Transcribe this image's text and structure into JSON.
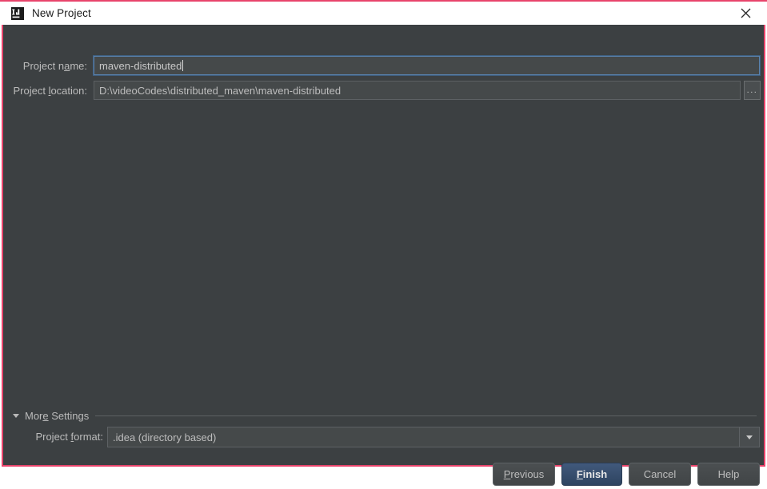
{
  "window": {
    "title": "New Project",
    "logo_icon": "intellij-idea-logo-icon",
    "close_icon": "close-icon",
    "border_color": "#e8446b",
    "titlebar_bg": "#ffffff",
    "body_bg": "#3c4042"
  },
  "fields": {
    "project_name": {
      "label_pre": "Project n",
      "label_mnemonic": "a",
      "label_post": "me:",
      "value": "maven-distributed",
      "focused": true,
      "focus_border_color": "#5a82ad"
    },
    "project_location": {
      "label_pre": "Project ",
      "label_mnemonic": "l",
      "label_post": "ocation:",
      "value": "D:\\videoCodes\\distributed_maven\\maven-distributed",
      "browse_button_label": "...",
      "browse_icon": "ellipsis-browse-icon"
    }
  },
  "more_settings": {
    "label_pre": "Mor",
    "label_mnemonic": "e",
    "label_post": " Settings",
    "expanded": true,
    "triangle_icon": "chevron-down-icon"
  },
  "project_format": {
    "label_pre": "Project ",
    "label_mnemonic": "f",
    "label_post": "ormat:",
    "value": ".idea (directory based)",
    "arrow_icon": "chevron-down-icon",
    "options": [
      ".idea (directory based)"
    ]
  },
  "buttons": {
    "previous": {
      "pre": "",
      "mnemonic": "P",
      "post": "revious"
    },
    "finish": {
      "pre": "",
      "mnemonic": "F",
      "post": "inish",
      "default": true,
      "accent": "#3c5a80"
    },
    "cancel": {
      "pre": "Cancel",
      "mnemonic": "",
      "post": ""
    },
    "help": {
      "pre": "Help",
      "mnemonic": "",
      "post": ""
    }
  }
}
